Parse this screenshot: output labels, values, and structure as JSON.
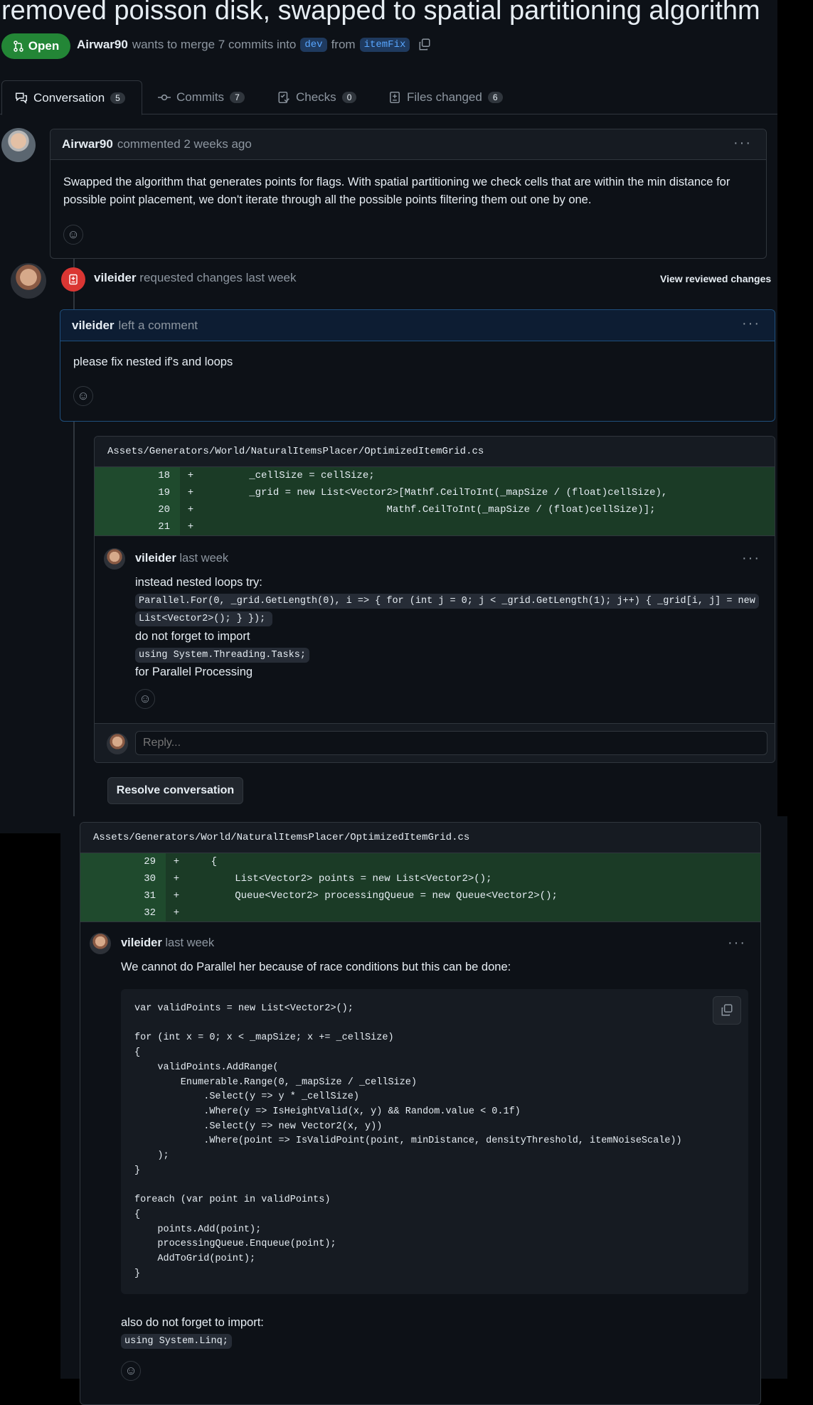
{
  "pr": {
    "title": "removed poisson disk, swapped to spatial partitioning algorithm",
    "state": "Open",
    "author": "Airwar90",
    "merge_text": "wants to merge 7 commits into",
    "base_branch": "dev",
    "from_text": "from",
    "head_branch": "itemFix"
  },
  "tabs": [
    {
      "label": "Conversation",
      "count": "5"
    },
    {
      "label": "Commits",
      "count": "7"
    },
    {
      "label": "Checks",
      "count": "0"
    },
    {
      "label": "Files changed",
      "count": "6"
    }
  ],
  "comment1": {
    "author": "Airwar90",
    "meta": "commented 2 weeks ago",
    "body": "Swapped the algorithm that generates points for flags. With spatial partitioning we check cells that are within the min distance for possible point placement, we don't iterate through all the possible points filtering them out one by one."
  },
  "review": {
    "author": "vileider",
    "meta": "requested changes last week",
    "view_changes": "View reviewed changes",
    "comment_author": "vileider",
    "comment_meta": "left a comment",
    "comment_body": "please fix nested if's and loops"
  },
  "thread1": {
    "file": "Assets/Generators/World/NaturalItemsPlacer/OptimizedItemGrid.cs",
    "lines": [
      {
        "num": "18",
        "code": "        _cellSize = cellSize;"
      },
      {
        "num": "19",
        "code": "        _grid = new List<Vector2>[Mathf.CeilToInt(_mapSize / (float)cellSize),"
      },
      {
        "num": "20",
        "code": "                               Mathf.CeilToInt(_mapSize / (float)cellSize)];"
      },
      {
        "num": "21",
        "code": ""
      }
    ],
    "author": "vileider",
    "time": "last week",
    "text1": "instead nested loops try:",
    "code1a": "Parallel.For(0, _grid.GetLength(0), i => { for (int j = 0; j < _grid.GetLength(1); j++) { _grid[i, j] = new",
    "code1b": "List<Vector2>(); } });",
    "text2": "do not forget to import",
    "code2": "using System.Threading.Tasks;",
    "text3": "for Parallel Processing",
    "reply_placeholder": "Reply...",
    "resolve_label": "Resolve conversation"
  },
  "thread2": {
    "file": "Assets/Generators/World/NaturalItemsPlacer/OptimizedItemGrid.cs",
    "lines": [
      {
        "num": "29",
        "code": "    {"
      },
      {
        "num": "30",
        "code": "        List<Vector2> points = new List<Vector2>();"
      },
      {
        "num": "31",
        "code": "        Queue<Vector2> processingQueue = new Queue<Vector2>();"
      },
      {
        "num": "32",
        "code": ""
      }
    ],
    "author": "vileider",
    "time": "last week",
    "text1": "We cannot do Parallel her because of race conditions but this can be done:",
    "code_block": "var validPoints = new List<Vector2>();\n\nfor (int x = 0; x < _mapSize; x += _cellSize)\n{\n    validPoints.AddRange(\n        Enumerable.Range(0, _mapSize / _cellSize)\n            .Select(y => y * _cellSize)\n            .Where(y => IsHeightValid(x, y) && Random.value < 0.1f)\n            .Select(y => new Vector2(x, y))\n            .Where(point => IsValidPoint(point, minDistance, densityThreshold, itemNoiseScale))\n    );\n}\n\nforeach (var point in validPoints)\n{\n    points.Add(point);\n    processingQueue.Enqueue(point);\n    AddToGrid(point);\n}",
    "text2": "also do not forget to import:",
    "code2": "using System.Linq;"
  }
}
